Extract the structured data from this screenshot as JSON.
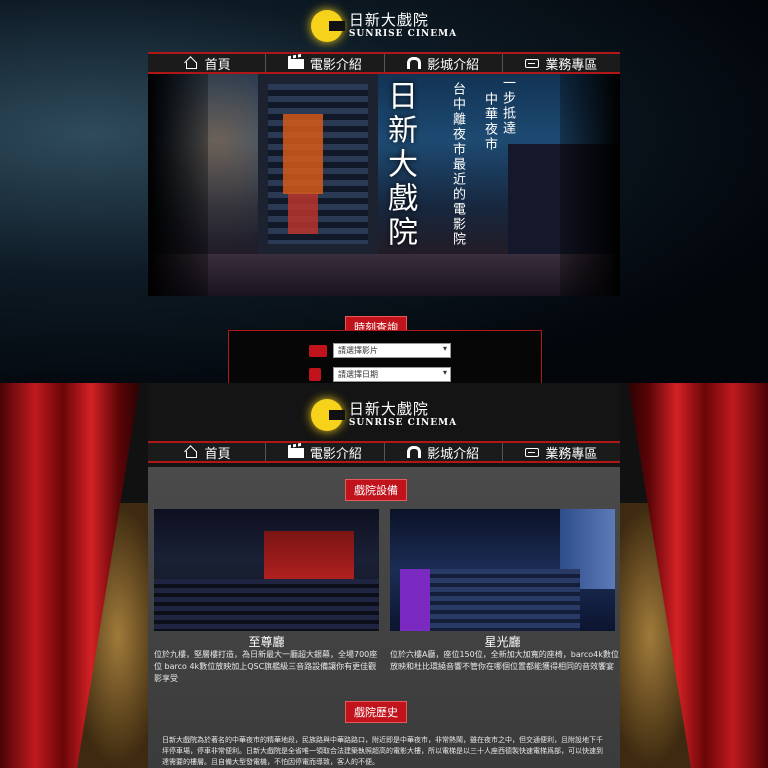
{
  "logo": {
    "name_cn": "日新大戲院",
    "name_en": "SUNRISE CINEMA"
  },
  "nav": [
    {
      "label": "首頁",
      "icon": "home-icon"
    },
    {
      "label": "電影介紹",
      "icon": "film-clapper-icon"
    },
    {
      "label": "影城介紹",
      "icon": "theater-arch-icon"
    },
    {
      "label": "業務專區",
      "icon": "ticket-icon"
    }
  ],
  "hero": {
    "title": "日新大戲院",
    "subtitle1": "台中離夜市最近的電影院",
    "subtitle2": "中華夜市",
    "subtitle3": "一步抵達"
  },
  "showtime": {
    "heading": "時刻查詢",
    "movie_placeholder": "請選擇影片",
    "date_placeholder": "請選擇日期"
  },
  "facilities": {
    "heading": "戲院設備",
    "halls": [
      {
        "name": "至尊廳",
        "desc": "位於九樓，堅層樓打造，為日新最大一廳超大銀幕，全場700座位 barco 4k數位放映加上QSC旗艦級三音路設備讓你有更佳觀影享受"
      },
      {
        "name": "星光廳",
        "desc": "位於六樓A廳，座位150位，全新加大加寬的座椅，barco4k數位放映和杜比環繞音響不管你在哪個位置都能獲得相同的音效饗宴"
      }
    ]
  },
  "history": {
    "heading": "戲院歷史",
    "text": "日新大戲院為於著名的中華夜市的精華地段，民族路與中華路路口，附近即是中華夜市，非常熱鬧，雖在夜市之中，但交通便利，且附設地下千坪停車場，停車非常便利。日新大戲院是全省唯一領取合法建築執照超高的電影大樓，所以電梯是以三十人座西德製快速電梯爲部，可以快速到達需要的樓層。且自備大型發電機，不怕因停電而導致，客人的不便。"
  },
  "colors": {
    "accent": "#c0131b",
    "logo_yellow": "#f6d21b",
    "nav_bg": "#1b1b1b"
  }
}
